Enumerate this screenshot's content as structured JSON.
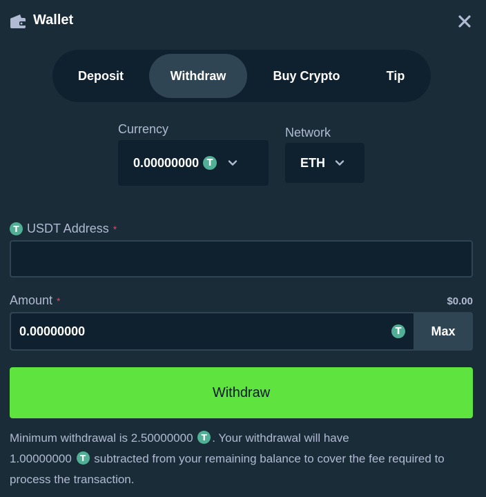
{
  "header": {
    "title": "Wallet",
    "icons": {
      "wallet": "wallet-icon",
      "close": "close-icon"
    }
  },
  "tabs": [
    {
      "label": "Deposit",
      "active": false
    },
    {
      "label": "Withdraw",
      "active": true
    },
    {
      "label": "Buy Crypto",
      "active": false
    },
    {
      "label": "Tip",
      "active": false
    }
  ],
  "currency": {
    "label": "Currency",
    "value": "0.00000000",
    "icon": "tether-icon"
  },
  "network": {
    "label": "Network",
    "value": "ETH"
  },
  "address": {
    "label": "USDT Address",
    "required_mark": "*",
    "value": "",
    "placeholder": ""
  },
  "amount": {
    "label": "Amount",
    "required_mark": "*",
    "usd_value": "$0.00",
    "value": "0.00000000",
    "max_label": "Max"
  },
  "withdraw_button": {
    "label": "Withdraw"
  },
  "footnote": {
    "part1": "Minimum withdrawal is 2.50000000",
    "part2": ". Your withdrawal will have",
    "part3": "1.00000000",
    "part4": "subtracted from your remaining balance to cover the fee required to process the transaction."
  },
  "colors": {
    "background": "#1a2c38",
    "panel": "#0f212e",
    "active_tab": "#2f4553",
    "accent_green": "#5fe33f",
    "muted_text": "#b1bad3",
    "tether": "#50af95",
    "required": "#ed4163"
  },
  "tether_glyph": "T"
}
